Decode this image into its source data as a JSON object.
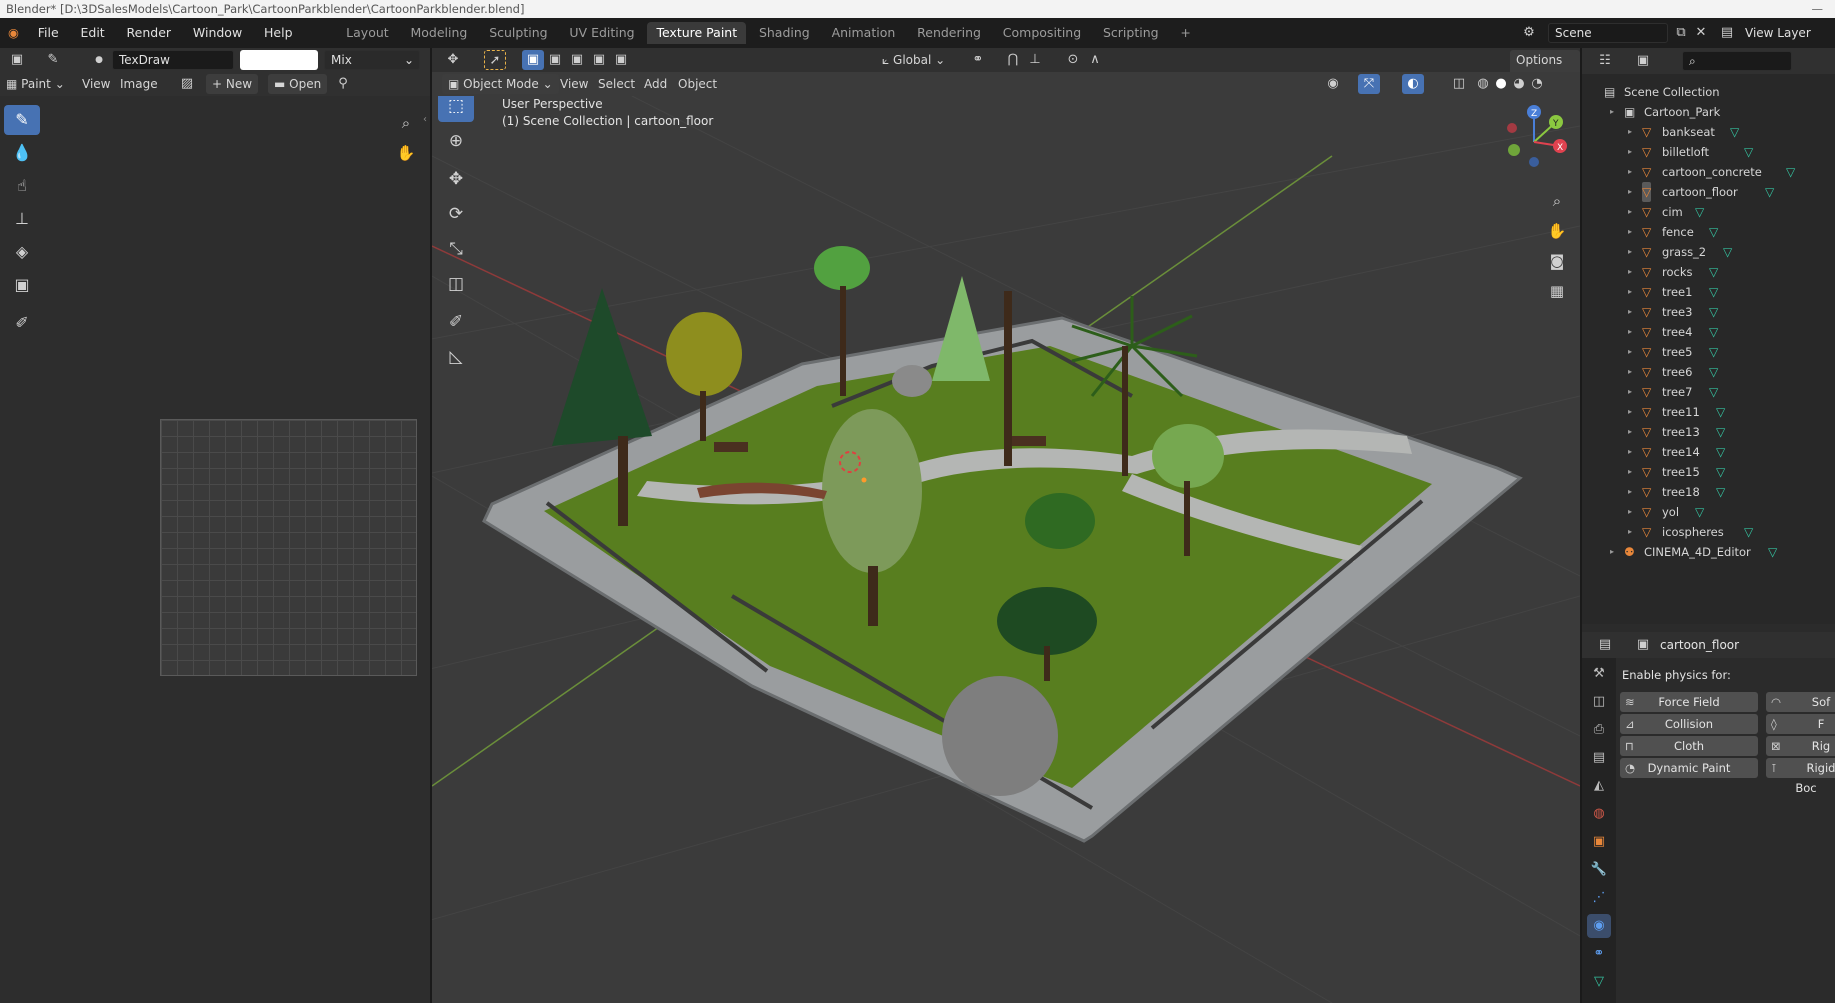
{
  "window_title": "Blender* [D:\\3DSalesModels\\Cartoon_Park\\CartoonParkblender\\CartoonParkblender.blend]",
  "menus": [
    "File",
    "Edit",
    "Render",
    "Window",
    "Help"
  ],
  "workspaces": [
    "Layout",
    "Modeling",
    "Sculpting",
    "UV Editing",
    "Texture Paint",
    "Shading",
    "Animation",
    "Rendering",
    "Compositing",
    "Scripting"
  ],
  "active_workspace": "Texture Paint",
  "scene_name": "Scene",
  "view_layer": "View Layer",
  "image_editor": {
    "brush_name": "TexDraw",
    "blend_mode": "Mix",
    "mode": "Paint",
    "view_menu": "View",
    "image_menu": "Image",
    "new_label": "New",
    "open_label": "Open"
  },
  "viewport": {
    "mode": "Object Mode",
    "menus": [
      "View",
      "Select",
      "Add",
      "Object"
    ],
    "transform_orientation": "Global",
    "options_label": "Options",
    "perspective_label": "User Perspective",
    "collection_label": "(1) Scene Collection | cartoon_floor",
    "gizmo": {
      "x": "X",
      "y": "Y",
      "z": "Z"
    }
  },
  "outliner": {
    "root": "Scene Collection",
    "collection": "Cartoon_Park",
    "objects": [
      "bankseat",
      "billetloft",
      "cartoon_concrete",
      "cartoon_floor",
      "cim",
      "fence",
      "grass_2",
      "rocks",
      "tree1",
      "tree3",
      "tree4",
      "tree5",
      "tree6",
      "tree7",
      "tree11",
      "tree13",
      "tree14",
      "tree15",
      "tree18",
      "yol",
      "icospheres"
    ],
    "selected": "cartoon_floor",
    "extra_object": "CINEMA_4D_Editor"
  },
  "properties": {
    "object_name": "cartoon_floor",
    "section_label": "Enable physics for:",
    "buttons_left": [
      "Force Field",
      "Collision",
      "Cloth",
      "Dynamic Paint"
    ],
    "buttons_right": [
      "Sof",
      "F",
      "Rig",
      "Rigid Boc"
    ]
  }
}
